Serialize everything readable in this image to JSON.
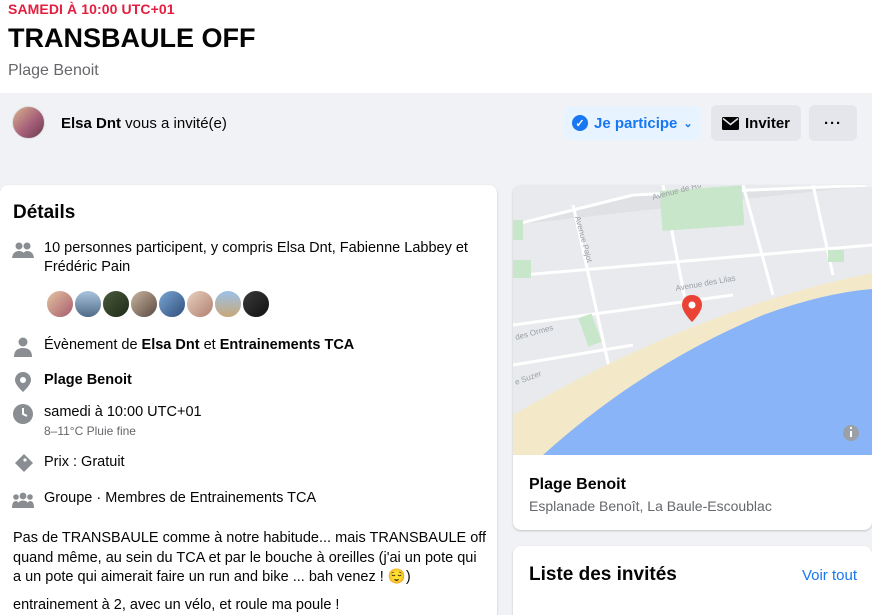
{
  "event": {
    "date": "SAMEDI À 10:00 UTC+01",
    "title": "TRANSBAULE OFF",
    "location": "Plage Benoit"
  },
  "invite_bar": {
    "inviter": "Elsa Dnt",
    "invite_suffix": " vous a invité(e)",
    "going_label": "Je participe",
    "invite_label": "Inviter",
    "more_label": "···"
  },
  "details": {
    "heading": "Détails",
    "participants": "10 personnes participent, y compris Elsa Dnt, Fabienne Labbey et Frédéric Pain",
    "event_by_prefix": "Évènement de ",
    "host1": "Elsa Dnt",
    "event_by_and": " et ",
    "host2": "Entrainements TCA",
    "place": "Plage Benoit",
    "time": "samedi à 10:00 UTC+01",
    "weather": "8–11°C Pluie fine",
    "price": "Prix : Gratuit",
    "group": "Groupe · Membres de Entrainements TCA",
    "description_1": "Pas de TRANSBAULE comme à notre habitude... mais TRANSBAULE off quand même, au sein du TCA et par le bouche à oreilles (j'ai un pote qui a un pote qui aimerait faire un run and bike ... bah venez ! 😌)",
    "description_2": "entrainement à 2, avec un vélo, et roule ma poule !"
  },
  "map": {
    "street_1": "Avenue de Ru",
    "street_2": "Avenue Pajot",
    "street_3": "Avenue des Lilas",
    "street_4": "des Ormes",
    "street_5": "e Suzer",
    "place_name": "Plage Benoit",
    "address": "Esplanade Benoît, La Baule-Escoublac"
  },
  "guests": {
    "heading": "Liste des invités",
    "see_all": "Voir tout"
  },
  "colors": {
    "accent": "#1877f2",
    "date_red": "#e41e3f",
    "sea": "#8ab4f8",
    "sand": "#f3e9c9"
  }
}
